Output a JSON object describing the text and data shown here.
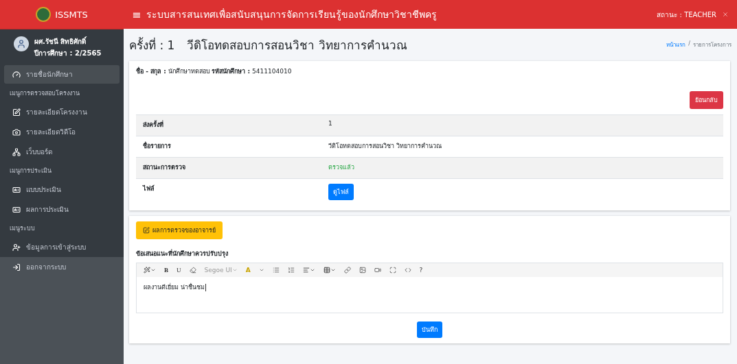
{
  "brand": "ISSMTS",
  "user": {
    "name": "ผศ.รัชนี สิทธิศักดิ์",
    "term": "ปีการศึกษา : 2/2565"
  },
  "sidebar": {
    "items": [
      {
        "kind": "item",
        "label": "รายชื่อนักศึกษา",
        "selected": true
      },
      {
        "kind": "header",
        "label": "เมนูการตรวจสอบโครงงาน"
      },
      {
        "kind": "item",
        "label": "รายละเอียดโครงงาน",
        "selected": false
      },
      {
        "kind": "item",
        "label": "รายละเอียดวิดีโอ",
        "selected": false
      },
      {
        "kind": "item",
        "label": "เว็บบอร์ด",
        "selected": false
      },
      {
        "kind": "header",
        "label": "เมนูการประเมิน"
      },
      {
        "kind": "item",
        "label": "แบบประเมิน",
        "selected": false
      },
      {
        "kind": "item",
        "label": "ผลการประเมิน",
        "selected": false
      },
      {
        "kind": "header",
        "label": "เมนูระบบ"
      },
      {
        "kind": "item",
        "label": "ข้อมูลการเข้าสู่ระบบ",
        "selected": false
      },
      {
        "kind": "item",
        "label": "ออกจากระบบ",
        "selected": false
      }
    ]
  },
  "topbar": {
    "menu_glyph": "≡",
    "title": "ระบบสารสนเทศเพื่อสนับสนุนการจัดการเรียนรู้ของนักศึกษาวิชาชีพครู",
    "status": "สถานะ : TEACHER"
  },
  "page": {
    "title_prefix": "ครั้งที่ : 1",
    "title": "วีดิโอทดสอบการสอนวิชา วิทยาการคำนวณ",
    "breadcrumb": [
      "หน้าแรก",
      "รายการโครงการ"
    ],
    "breadcrumb_separator": "/"
  },
  "student": {
    "name_label": "ชื่อ - สกุล :",
    "name": "นักศึกษาทดสอบ",
    "id_label": "รหัสนักศึกษา :",
    "id": "5411104010"
  },
  "back_button": "ย้อนกลับ",
  "details": [
    {
      "kind": "text",
      "label": "ส่งครั้งที่",
      "value": "1"
    },
    {
      "kind": "text",
      "label": "ชื่อรายการ",
      "value": "วีดิโอทดสอบการสอนวิชา วิทยาการคำนวณ"
    },
    {
      "kind": "status",
      "label": "สถานะการตรวจ",
      "value": "ตรวจแล้ว"
    },
    {
      "kind": "button",
      "label": "ไฟล์",
      "value": "ดูไฟล์"
    }
  ],
  "review_button": "ผลการตรวจของอาจารย์",
  "feedback": {
    "label": "ข้อเสนอแนะที่นักศึกษาควรปรับปรุง",
    "toolbar": {
      "bold": "B",
      "underline": "U",
      "font": "Segoe UI",
      "letter_a": "A",
      "help": "?"
    },
    "value": "ผลงานดีเยี่ยม น่าชื่นชม"
  },
  "save_button": "บันทึก"
}
